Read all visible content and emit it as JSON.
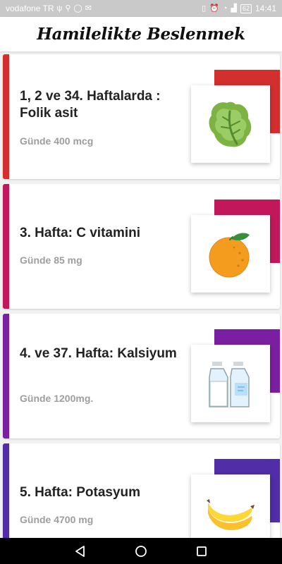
{
  "status_bar": {
    "carrier": "vodafone TR",
    "battery": "62",
    "time": "14:41"
  },
  "app_bar": {
    "title": "Hamilelikte Beslenmek"
  },
  "cards": [
    {
      "title": "1, 2 ve 34. Haftalarda : Folik asit",
      "subtitle": "Günde 400 mcg",
      "accent_color": "#d32f2f",
      "icon": "lettuce-icon"
    },
    {
      "title": "3. Hafta: C vitamini",
      "subtitle": "Günde 85 mg",
      "accent_color": "#c2185b",
      "icon": "orange-icon"
    },
    {
      "title": "4. ve 37. Hafta: Kalsiyum",
      "subtitle": "Günde 1200mg.",
      "accent_color": "#7b1fa2",
      "icon": "milk-bottles-icon"
    },
    {
      "title": "5. Hafta: Potasyum",
      "subtitle": "Günde 4700 mg",
      "accent_color": "#512da8",
      "icon": "banana-icon"
    }
  ]
}
